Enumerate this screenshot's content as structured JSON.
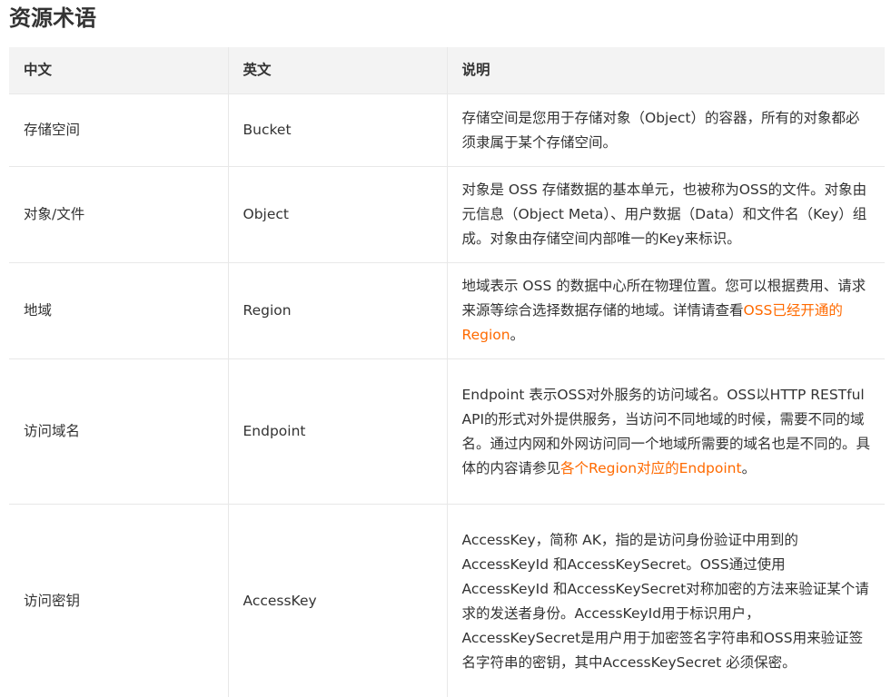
{
  "title": "资源术语",
  "table": {
    "headers": [
      "中文",
      "英文",
      "说明"
    ],
    "rows": [
      {
        "zh": "存储空间",
        "en": "Bucket",
        "desc": "存储空间是您用于存储对象（Object）的容器，所有的对象都必须隶属于某个存储空间。"
      },
      {
        "zh": "对象/文件",
        "en": "Object",
        "desc": "对象是 OSS 存储数据的基本单元，也被称为OSS的文件。对象由元信息（Object Meta）、用户数据（Data）和文件名（Key）组成。对象由存储空间内部唯一的Key来标识。"
      },
      {
        "zh": "地域",
        "en": "Region",
        "desc": "地域表示 OSS 的数据中心所在物理位置。您可以根据费用、请求来源等综合选择数据存储的地域。详情请查看",
        "link": "OSS已经开通的Region",
        "suffix": "。"
      },
      {
        "zh": "访问域名",
        "en": "Endpoint",
        "desc": "Endpoint 表示OSS对外服务的访问域名。OSS以HTTP RESTful API的形式对外提供服务，当访问不同地域的时候，需要不同的域名。通过内网和外网访问同一个地域所需要的域名也是不同的。具体的内容请参见",
        "link": "各个Region对应的Endpoint",
        "suffix": "。"
      },
      {
        "zh": "访问密钥",
        "en": "AccessKey",
        "desc": "AccessKey，简称 AK，指的是访问身份验证中用到的AccessKeyId 和AccessKeySecret。OSS通过使用AccessKeyId 和AccessKeySecret对称加密的方法来验证某个请求的发送者身份。AccessKeyId用于标识用户，AccessKeySecret是用户用于加密签名字符串和OSS用来验证签名字符串的密钥，其中AccessKeySecret 必须保密。"
      }
    ]
  },
  "colors": {
    "link": "#ff6a00",
    "header_bg": "#f3f3f3",
    "border": "#e8e8e8",
    "text": "#333333"
  }
}
